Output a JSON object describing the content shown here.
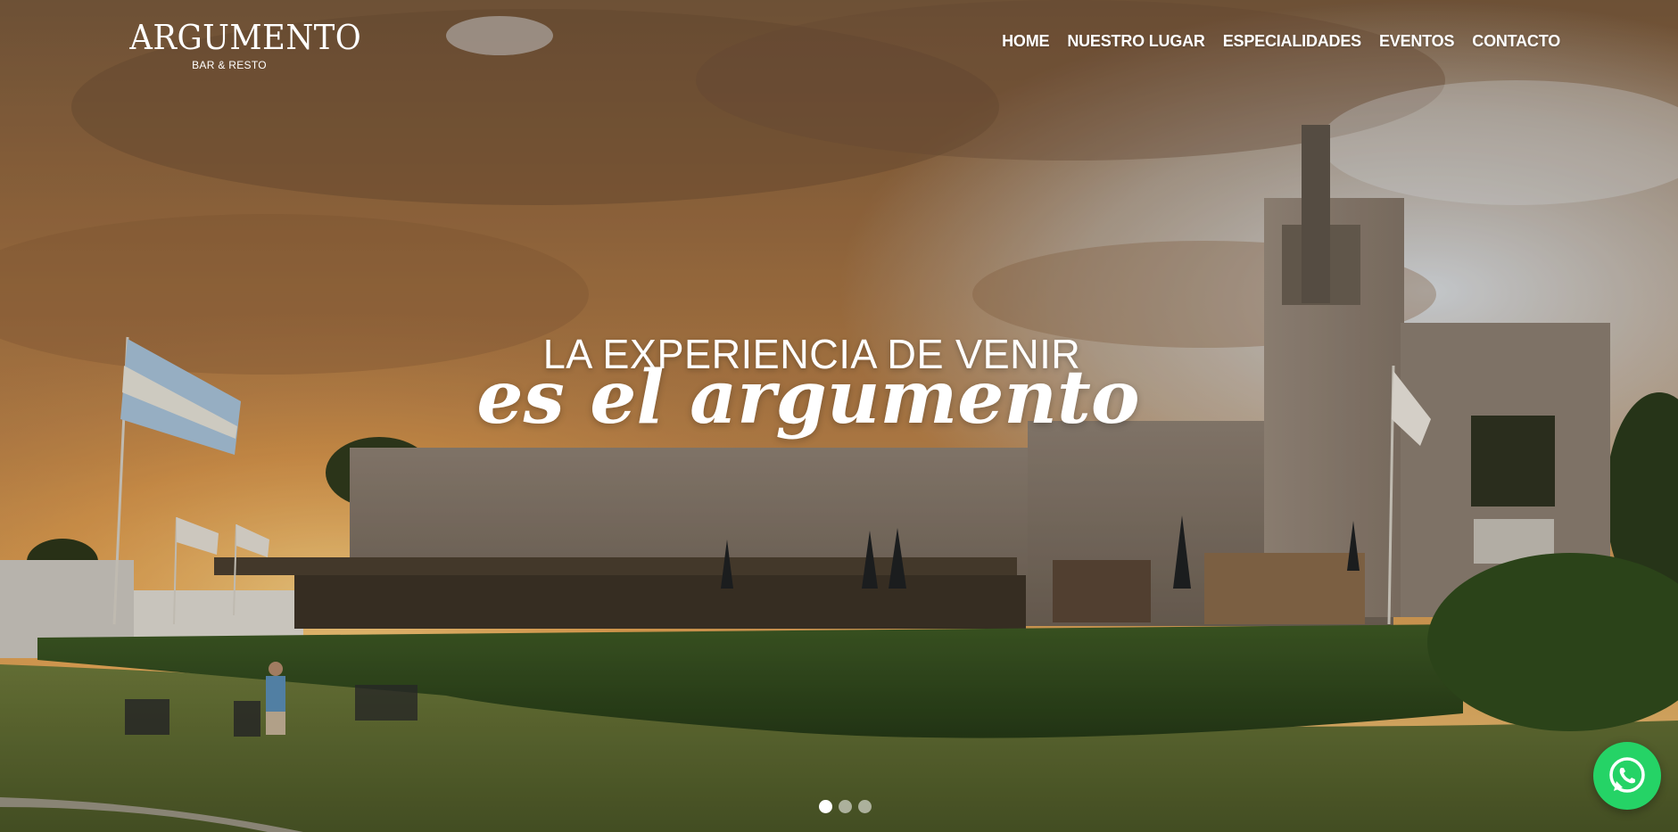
{
  "brand": {
    "name": "ARGUMENTO",
    "tagline": "BAR & RESTO"
  },
  "nav": {
    "items": [
      {
        "label": "HOME"
      },
      {
        "label": "NUESTRO LUGAR"
      },
      {
        "label": "ESPECIALIDADES"
      },
      {
        "label": "EVENTOS"
      },
      {
        "label": "CONTACTO"
      }
    ]
  },
  "hero": {
    "headline_top": "LA EXPERIENCIA DE VENIR",
    "headline_bottom": "es el argumento",
    "background_icon": "sunset-clubhouse-photo",
    "slides": {
      "count": 3,
      "active": 1
    }
  },
  "whatsapp": {
    "icon": "whatsapp-icon",
    "color": "#25d366"
  },
  "colors": {
    "text": "#ffffff",
    "sky_warm": "#c98a45",
    "grass": "#5c6d2f"
  }
}
